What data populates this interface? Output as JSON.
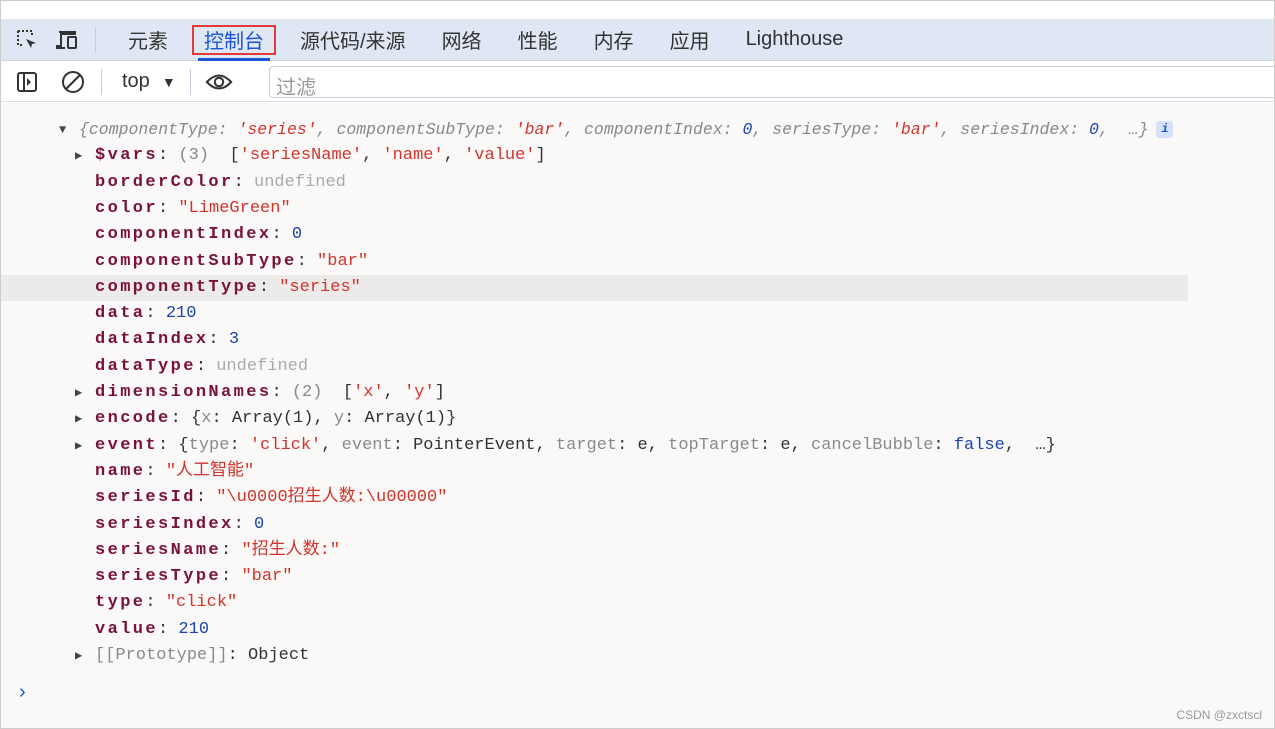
{
  "tabs": [
    {
      "label": "元素"
    },
    {
      "label": "控制台",
      "active": true
    },
    {
      "label": "源代码/来源"
    },
    {
      "label": "网络"
    },
    {
      "label": "性能"
    },
    {
      "label": "内存"
    },
    {
      "label": "应用"
    },
    {
      "label": "Lighthouse"
    }
  ],
  "toolbar": {
    "context": "top",
    "filter_placeholder": "过滤"
  },
  "console": {
    "lines": [
      {
        "indent": 0,
        "toggle": "▼",
        "summary": true,
        "info": "i",
        "segs": [
          [
            "{componentType: ",
            "g"
          ],
          [
            "'series'",
            "s"
          ],
          [
            ", componentSubType: ",
            "g"
          ],
          [
            "'bar'",
            "s"
          ],
          [
            ", componentIndex: ",
            "g"
          ],
          [
            "0",
            "n"
          ],
          [
            ", seriesType: ",
            "g"
          ],
          [
            "'bar'",
            "s"
          ],
          [
            ", seriesIndex: ",
            "g"
          ],
          [
            "0",
            "n"
          ],
          [
            ",  …}",
            "g"
          ]
        ]
      },
      {
        "indent": 1,
        "toggle": "▶",
        "segs": [
          [
            "$vars",
            "k"
          ],
          [
            ": ",
            "p"
          ],
          [
            "(3)  ",
            "g"
          ],
          [
            "[",
            "p"
          ],
          [
            "'seriesName'",
            "s"
          ],
          [
            ", ",
            "p"
          ],
          [
            "'name'",
            "s"
          ],
          [
            ", ",
            "p"
          ],
          [
            "'value'",
            "s"
          ],
          [
            "]",
            "p"
          ]
        ]
      },
      {
        "indent": 1,
        "segs": [
          [
            "borderColor",
            "k"
          ],
          [
            ": ",
            "p"
          ],
          [
            "undefined",
            "u"
          ]
        ]
      },
      {
        "indent": 1,
        "segs": [
          [
            "color",
            "k"
          ],
          [
            ": ",
            "p"
          ],
          [
            "\"LimeGreen\"",
            "s"
          ]
        ]
      },
      {
        "indent": 1,
        "segs": [
          [
            "componentIndex",
            "k"
          ],
          [
            ": ",
            "p"
          ],
          [
            "0",
            "n"
          ]
        ]
      },
      {
        "indent": 1,
        "segs": [
          [
            "componentSubType",
            "k"
          ],
          [
            ": ",
            "p"
          ],
          [
            "\"bar\"",
            "s"
          ]
        ]
      },
      {
        "indent": 1,
        "highlight": true,
        "segs": [
          [
            "componentType",
            "k"
          ],
          [
            ": ",
            "p"
          ],
          [
            "\"series\"",
            "s"
          ]
        ]
      },
      {
        "indent": 1,
        "segs": [
          [
            "data",
            "k"
          ],
          [
            ": ",
            "p"
          ],
          [
            "210",
            "n"
          ]
        ]
      },
      {
        "indent": 1,
        "segs": [
          [
            "dataIndex",
            "k"
          ],
          [
            ": ",
            "p"
          ],
          [
            "3",
            "n"
          ]
        ]
      },
      {
        "indent": 1,
        "segs": [
          [
            "dataType",
            "k"
          ],
          [
            ": ",
            "p"
          ],
          [
            "undefined",
            "u"
          ]
        ]
      },
      {
        "indent": 1,
        "toggle": "▶",
        "segs": [
          [
            "dimensionNames",
            "k"
          ],
          [
            ": ",
            "p"
          ],
          [
            "(2)  ",
            "g"
          ],
          [
            "[",
            "p"
          ],
          [
            "'x'",
            "s"
          ],
          [
            ", ",
            "p"
          ],
          [
            "'y'",
            "s"
          ],
          [
            "]",
            "p"
          ]
        ]
      },
      {
        "indent": 1,
        "toggle": "▶",
        "segs": [
          [
            "encode",
            "k"
          ],
          [
            ": ",
            "p"
          ],
          [
            "{",
            "p"
          ],
          [
            "x",
            "kg"
          ],
          [
            ": Array(1), ",
            "p"
          ],
          [
            "y",
            "kg"
          ],
          [
            ": Array(1)}",
            "p"
          ]
        ]
      },
      {
        "indent": 1,
        "toggle": "▶",
        "segs": [
          [
            "event",
            "k"
          ],
          [
            ": {",
            "p"
          ],
          [
            "type",
            "kg"
          ],
          [
            ": ",
            "p"
          ],
          [
            "'click'",
            "s"
          ],
          [
            ", ",
            "p"
          ],
          [
            "event",
            "kg"
          ],
          [
            ": PointerEvent, ",
            "p"
          ],
          [
            "target",
            "kg"
          ],
          [
            ": e, ",
            "p"
          ],
          [
            "topTarget",
            "kg"
          ],
          [
            ": e, ",
            "p"
          ],
          [
            "cancelBubble",
            "kg"
          ],
          [
            ": ",
            "p"
          ],
          [
            "false",
            "n"
          ],
          [
            ",  …}",
            "p"
          ]
        ]
      },
      {
        "indent": 1,
        "segs": [
          [
            "name",
            "k"
          ],
          [
            ": ",
            "p"
          ],
          [
            "\"人工智能\"",
            "s"
          ]
        ]
      },
      {
        "indent": 1,
        "segs": [
          [
            "seriesId",
            "k"
          ],
          [
            ": ",
            "p"
          ],
          [
            "\"\\u0000招生人数:\\u00000\"",
            "s"
          ]
        ]
      },
      {
        "indent": 1,
        "segs": [
          [
            "seriesIndex",
            "k"
          ],
          [
            ": ",
            "p"
          ],
          [
            "0",
            "n"
          ]
        ]
      },
      {
        "indent": 1,
        "segs": [
          [
            "seriesName",
            "k"
          ],
          [
            ": ",
            "p"
          ],
          [
            "\"招生人数:\"",
            "s"
          ]
        ]
      },
      {
        "indent": 1,
        "segs": [
          [
            "seriesType",
            "k"
          ],
          [
            ": ",
            "p"
          ],
          [
            "\"bar\"",
            "s"
          ]
        ]
      },
      {
        "indent": 1,
        "segs": [
          [
            "type",
            "k"
          ],
          [
            ": ",
            "p"
          ],
          [
            "\"click\"",
            "s"
          ]
        ]
      },
      {
        "indent": 1,
        "segs": [
          [
            "value",
            "k"
          ],
          [
            ": ",
            "p"
          ],
          [
            "210",
            "n"
          ]
        ]
      },
      {
        "indent": 1,
        "toggle": "▶",
        "segs": [
          [
            "[[Prototype]]",
            "kg"
          ],
          [
            ": Object",
            "p"
          ]
        ]
      }
    ],
    "prompt": "›"
  },
  "watermark": "CSDN @zxctscl",
  "colors": {
    "accent": "#1a55d6",
    "highlight_box": "#e23a3a",
    "key": "#7a1238",
    "string": "#d2342c",
    "number": "#1a44b0"
  }
}
